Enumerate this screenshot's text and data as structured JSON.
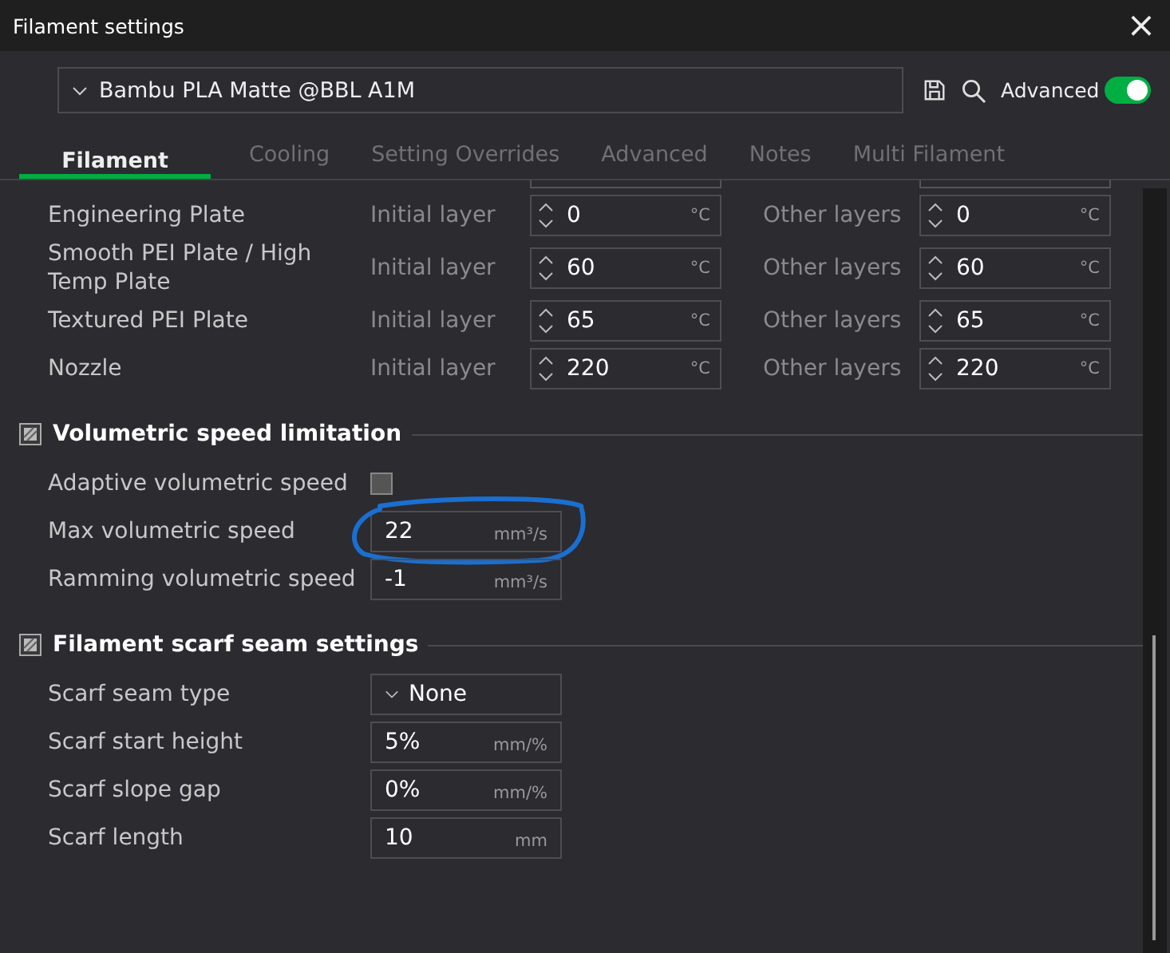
{
  "window": {
    "title": "Filament settings",
    "close": "×"
  },
  "preset": {
    "value": "Bambu PLA Matte @BBL A1M"
  },
  "advanced": {
    "label": "Advanced",
    "on": true
  },
  "tabs": [
    {
      "label": "Filament",
      "selected": true
    },
    {
      "label": "Cooling",
      "selected": false
    },
    {
      "label": "Setting Overrides",
      "selected": false
    },
    {
      "label": "Advanced",
      "selected": false
    },
    {
      "label": "Notes",
      "selected": false
    },
    {
      "label": "Multi Filament",
      "selected": false
    }
  ],
  "plate_temperatures": [
    {
      "label": "Engineering Plate",
      "initial_label": "Initial layer",
      "initial": "0",
      "unit": "°C",
      "other_label": "Other layers",
      "other": "0",
      "other_unit": "°C"
    },
    {
      "label": "Smooth PEI Plate / High Temp Plate",
      "initial_label": "Initial layer",
      "initial": "60",
      "unit": "°C",
      "other_label": "Other layers",
      "other": "60",
      "other_unit": "°C"
    },
    {
      "label": "Textured PEI Plate",
      "initial_label": "Initial layer",
      "initial": "65",
      "unit": "°C",
      "other_label": "Other layers",
      "other": "65",
      "other_unit": "°C"
    },
    {
      "label": "Nozzle",
      "initial_label": "Initial layer",
      "initial": "220",
      "unit": "°C",
      "other_label": "Other layers",
      "other": "220",
      "other_unit": "°C"
    }
  ],
  "sections": [
    {
      "title": "Volumetric speed limitation",
      "rows": [
        {
          "kind": "checkbox",
          "label": "Adaptive volumetric speed",
          "checked": false
        },
        {
          "kind": "number",
          "label": "Max volumetric speed",
          "value": "22",
          "unit": "mm³/s",
          "circled": true
        },
        {
          "kind": "number",
          "label": "Ramming volumetric speed",
          "value": "-1",
          "unit": "mm³/s",
          "circled": false
        }
      ]
    },
    {
      "title": "Filament scarf seam settings",
      "rows": [
        {
          "kind": "select",
          "label": "Scarf seam type",
          "value": "None"
        },
        {
          "kind": "number",
          "label": "Scarf start height",
          "value": "5%",
          "unit": "mm/%",
          "circled": false
        },
        {
          "kind": "number",
          "label": "Scarf slope gap",
          "value": "0%",
          "unit": "mm/%",
          "circled": false
        },
        {
          "kind": "number",
          "label": "Scarf length",
          "value": "10",
          "unit": "mm",
          "circled": false
        }
      ]
    }
  ]
}
